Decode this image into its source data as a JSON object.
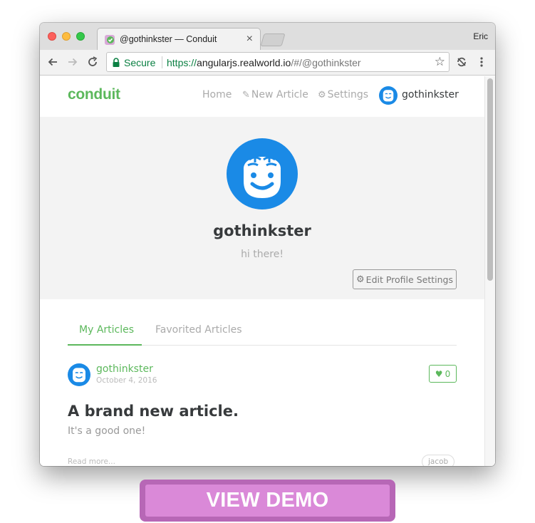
{
  "browser": {
    "tab_title": "@gothinkster — Conduit",
    "profile_name": "Eric",
    "secure_label": "Secure",
    "url_scheme": "https://",
    "url_host": "angularjs.realworld.io",
    "url_path": "/#/@gothinkster",
    "close_glyph": "×",
    "star_glyph": "☆"
  },
  "app": {
    "brand": "conduit",
    "accent_color": "#5cb85c",
    "nav": {
      "home": "Home",
      "new_article": "New Article",
      "settings": "Settings",
      "user": "gothinkster"
    },
    "profile": {
      "username": "gothinkster",
      "bio": "hi there!",
      "edit_button": "Edit Profile Settings"
    },
    "tabs": {
      "my_articles": "My Articles",
      "favorited_articles": "Favorited Articles"
    },
    "article": {
      "author": "gothinkster",
      "date": "October 4, 2016",
      "favorites_count": "0",
      "title": "A brand new article.",
      "description": "It's a good one!",
      "read_more": "Read more...",
      "tag": "jacob"
    }
  },
  "demo_button": {
    "label": "VIEW DEMO",
    "color": "#da89d8"
  }
}
